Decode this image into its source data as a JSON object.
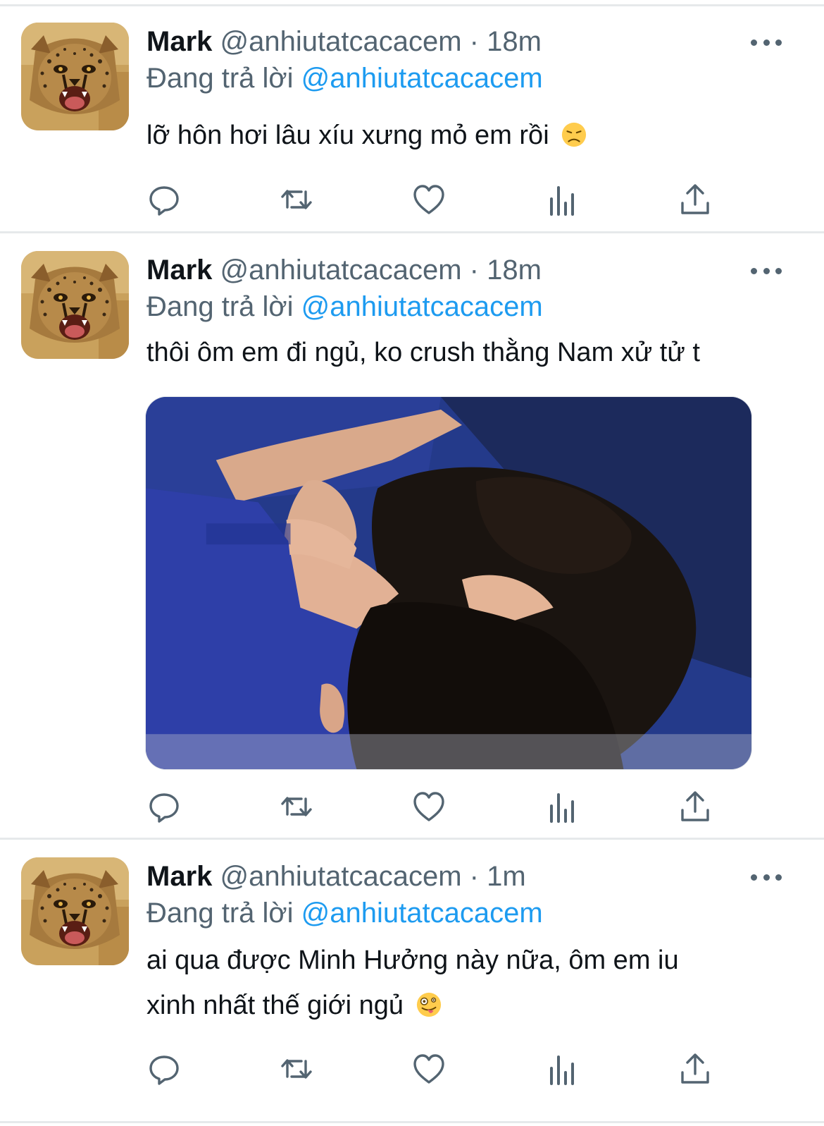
{
  "colors": {
    "accent": "#1d9bf0",
    "secondary_text": "#536471",
    "divider": "#e6e9eb"
  },
  "tweets": [
    {
      "name": "Mark",
      "handle": "@anhiutatcacacem",
      "separator": "·",
      "time": "18m",
      "reply_prefix": "Đang trả lời",
      "reply_to": "@anhiutatcacacem",
      "text": "lỡ hôn hơi lâu xíu xưng mỏ em rồi",
      "emoji": "disappointed-face",
      "avatar": "cheetah-cub",
      "has_media": false
    },
    {
      "name": "Mark",
      "handle": "@anhiutatcacacem",
      "separator": "·",
      "time": "18m",
      "reply_prefix": "Đang trả lời",
      "reply_to": "@anhiutatcacacem",
      "text": "thôi ôm em đi ngủ, ko crush thằng Nam xử tử t",
      "avatar": "cheetah-cub",
      "has_media": true,
      "media_description": "two-people-hugging-photo"
    },
    {
      "name": "Mark",
      "handle": "@anhiutatcacacem",
      "separator": "·",
      "time": "1m",
      "reply_prefix": "Đang trả lời",
      "reply_to": "@anhiutatcacacem",
      "text_line1": "ai qua được Minh Hưởng này nữa, ôm em iu",
      "text_line2": "xinh nhất thế giới ngủ",
      "emoji": "zany-face",
      "avatar": "cheetah-cub",
      "has_media": false
    }
  ],
  "actions": [
    "reply-icon",
    "retweet-icon",
    "like-icon",
    "analytics-icon",
    "share-icon"
  ]
}
